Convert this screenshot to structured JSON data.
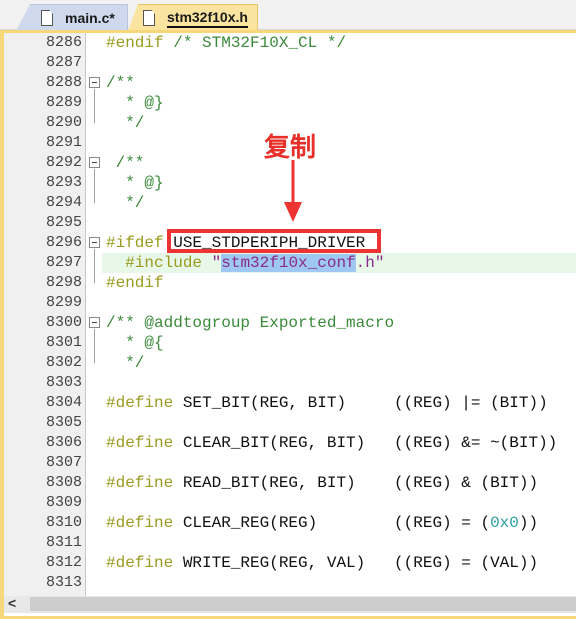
{
  "tabs": [
    {
      "label": "main.c*",
      "active": false
    },
    {
      "label": "stm32f10x.h",
      "active": true
    }
  ],
  "colors": {
    "annotation": "#ee3333",
    "tab_active": "#fbe3a0",
    "preprocessor": "#9a9a1e",
    "comment": "#3a8a3a",
    "selection": "#9fc8f0"
  },
  "annotation": {
    "label": "复制",
    "boxed_text": "USE_STDPERIPH_DRIVER",
    "arrow": "arrow-down"
  },
  "lines": [
    {
      "n": "8286",
      "fold": false,
      "t": [
        [
          "pp",
          "#endif "
        ],
        [
          "cm",
          "/* STM32F10X_CL */"
        ]
      ]
    },
    {
      "n": "8287",
      "t": []
    },
    {
      "n": "8288",
      "fold": true,
      "t": [
        [
          "cm",
          "/**"
        ]
      ]
    },
    {
      "n": "8289",
      "t": [
        [
          "cm",
          "  * @}"
        ]
      ]
    },
    {
      "n": "8290",
      "t": [
        [
          "cm",
          "  */"
        ]
      ]
    },
    {
      "n": "8291",
      "t": []
    },
    {
      "n": "8292",
      "fold": true,
      "t": [
        [
          "cm",
          " /**"
        ]
      ]
    },
    {
      "n": "8293",
      "t": [
        [
          "cm",
          "  * @}"
        ]
      ]
    },
    {
      "n": "8294",
      "t": [
        [
          "cm",
          "  */"
        ]
      ]
    },
    {
      "n": "8295",
      "t": []
    },
    {
      "n": "8296",
      "fold": true,
      "t": [
        [
          "pp",
          "#ifdef "
        ],
        [
          "",
          "USE_STDPERIPH_DRIVER"
        ]
      ]
    },
    {
      "n": "8297",
      "cur": true,
      "t": [
        [
          "pp",
          "  #include "
        ],
        [
          "st",
          "\""
        ],
        [
          "st sel",
          "stm32f10x_conf"
        ],
        [
          "st",
          ".h\""
        ]
      ]
    },
    {
      "n": "8298",
      "t": [
        [
          "pp",
          "#endif"
        ]
      ]
    },
    {
      "n": "8299",
      "t": []
    },
    {
      "n": "8300",
      "fold": true,
      "t": [
        [
          "cm",
          "/** @addtogroup Exported_macro"
        ]
      ]
    },
    {
      "n": "8301",
      "t": [
        [
          "cm",
          "  * @{"
        ]
      ]
    },
    {
      "n": "8302",
      "t": [
        [
          "cm",
          "  */"
        ]
      ]
    },
    {
      "n": "8303",
      "t": []
    },
    {
      "n": "8304",
      "t": [
        [
          "pp",
          "#define "
        ],
        [
          "",
          "SET_BIT(REG, BIT)     ((REG) |= (BIT))"
        ]
      ]
    },
    {
      "n": "8305",
      "t": []
    },
    {
      "n": "8306",
      "t": [
        [
          "pp",
          "#define "
        ],
        [
          "",
          "CLEAR_BIT(REG, BIT)   ((REG) &= ~(BIT))"
        ]
      ]
    },
    {
      "n": "8307",
      "t": []
    },
    {
      "n": "8308",
      "t": [
        [
          "pp",
          "#define "
        ],
        [
          "",
          "READ_BIT(REG, BIT)    ((REG) & (BIT))"
        ]
      ]
    },
    {
      "n": "8309",
      "t": []
    },
    {
      "n": "8310",
      "t": [
        [
          "pp",
          "#define "
        ],
        [
          "",
          "CLEAR_REG(REG)        ((REG) = ("
        ],
        [
          "nm",
          "0x0"
        ],
        [
          "",
          "))"
        ]
      ]
    },
    {
      "n": "8311",
      "t": []
    },
    {
      "n": "8312",
      "t": [
        [
          "pp",
          "#define "
        ],
        [
          "",
          "WRITE_REG(REG, VAL)   ((REG) = (VAL))"
        ]
      ]
    },
    {
      "n": "8313",
      "t": []
    }
  ]
}
